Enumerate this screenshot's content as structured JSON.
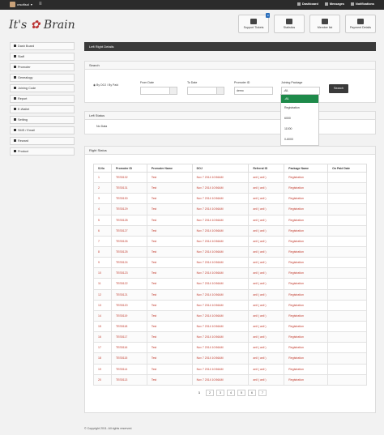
{
  "topbar": {
    "user": "crsoftsol",
    "links": [
      "Dashboard",
      "Messages",
      "Notifications"
    ]
  },
  "logo": {
    "left": "It's",
    "right": "Brain"
  },
  "top_buttons": [
    {
      "label": "Support Tickets",
      "icon": "chat-icon",
      "badge": "0"
    },
    {
      "label": "Statistics",
      "icon": "list-icon"
    },
    {
      "label": "Member list",
      "icon": "users-icon"
    },
    {
      "label": "Payment Details",
      "icon": "payment-icon"
    }
  ],
  "sidebar": {
    "items": [
      {
        "label": "Dash Board",
        "icon": "grid-icon"
      },
      {
        "label": "Staff",
        "icon": "user-icon"
      },
      {
        "label": "Promoter",
        "icon": "user-icon"
      },
      {
        "label": "Genealogy",
        "icon": "tree-icon"
      },
      {
        "label": "Joining Code",
        "icon": "code-icon"
      },
      {
        "label": "Report",
        "icon": "report-icon"
      },
      {
        "label": "E-Wallet",
        "icon": "wallet-icon"
      },
      {
        "label": "Setting",
        "icon": "gear-icon"
      },
      {
        "label": "SMS / Email",
        "icon": "mail-icon"
      },
      {
        "label": "Reward",
        "icon": "reward-icon"
      },
      {
        "label": "Product",
        "icon": "product-icon"
      }
    ]
  },
  "page_title": "Left Right Details",
  "search": {
    "title": "Search",
    "radio_label": "By DOJ / By Paid",
    "from_label": "From Date",
    "to_label": "To Date",
    "promoter_label": "Promoter ID",
    "promoter_value": "demo",
    "package_label": "Joining Package",
    "package_value": "-All-",
    "package_options": [
      "-All-",
      "Registration",
      "6000",
      "11000",
      "0-6000"
    ],
    "button": "Search"
  },
  "left_status": {
    "title": "Left Status",
    "empty": "No Data"
  },
  "right_status": {
    "title": "Right Status",
    "columns": [
      "S.No",
      "Promoter ID",
      "Promoter Name",
      "DOJ",
      "Referral ID",
      "Package Name",
      "On Paid Date"
    ],
    "rows": [
      [
        "1",
        "TES5132",
        "Test",
        "Nov 7 2014 10:56AM",
        "anil ( anil )",
        "Registration",
        ""
      ],
      [
        "2",
        "TES5131",
        "Test",
        "Nov 7 2014 10:56AM",
        "anil ( anil )",
        "Registration",
        ""
      ],
      [
        "3",
        "TES5130",
        "Test",
        "Nov 7 2014 10:56AM",
        "anil ( anil )",
        "Registration",
        ""
      ],
      [
        "4",
        "TES5129",
        "Test",
        "Nov 7 2014 10:56AM",
        "anil ( anil )",
        "Registration",
        ""
      ],
      [
        "5",
        "TES5128",
        "Test",
        "Nov 7 2014 10:56AM",
        "anil ( anil )",
        "Registration",
        ""
      ],
      [
        "6",
        "TES5127",
        "Test",
        "Nov 7 2014 10:56AM",
        "anil ( anil )",
        "Registration",
        ""
      ],
      [
        "7",
        "TES5126",
        "Test",
        "Nov 7 2014 10:56AM",
        "anil ( anil )",
        "Registration",
        ""
      ],
      [
        "8",
        "TES5125",
        "Test",
        "Nov 7 2014 10:56AM",
        "anil ( anil )",
        "Registration",
        ""
      ],
      [
        "9",
        "TES5124",
        "Test",
        "Nov 7 2014 10:56AM",
        "anil ( anil )",
        "Registration",
        ""
      ],
      [
        "10",
        "TES5123",
        "Test",
        "Nov 7 2014 10:56AM",
        "anil ( anil )",
        "Registration",
        ""
      ],
      [
        "11",
        "TES5122",
        "Test",
        "Nov 7 2014 10:56AM",
        "anil ( anil )",
        "Registration",
        ""
      ],
      [
        "12",
        "TES5121",
        "Test",
        "Nov 7 2014 10:56AM",
        "anil ( anil )",
        "Registration",
        ""
      ],
      [
        "13",
        "TES5120",
        "Test",
        "Nov 7 2014 10:56AM",
        "anil ( anil )",
        "Registration",
        ""
      ],
      [
        "14",
        "TES5119",
        "Test",
        "Nov 7 2014 10:56AM",
        "anil ( anil )",
        "Registration",
        ""
      ],
      [
        "15",
        "TES5118",
        "Test",
        "Nov 7 2014 10:56AM",
        "anil ( anil )",
        "Registration",
        ""
      ],
      [
        "16",
        "TES5117",
        "Test",
        "Nov 7 2014 10:56AM",
        "anil ( anil )",
        "Registration",
        ""
      ],
      [
        "17",
        "TES5116",
        "Test",
        "Nov 7 2014 10:56AM",
        "anil ( anil )",
        "Registration",
        ""
      ],
      [
        "18",
        "TES5115",
        "Test",
        "Nov 7 2014 10:56AM",
        "anil ( anil )",
        "Registration",
        ""
      ],
      [
        "19",
        "TES5114",
        "Test",
        "Nov 7 2014 10:56AM",
        "anil ( anil )",
        "Registration",
        ""
      ],
      [
        "20",
        "TES5113",
        "Test",
        "Nov 7 2014 10:56AM",
        "anil ( anil )",
        "Registration",
        ""
      ]
    ],
    "pages": [
      "1",
      "2",
      "3",
      "4",
      "5",
      "6",
      "7"
    ]
  },
  "footer": "© Copyright 2011. All rights reserved."
}
